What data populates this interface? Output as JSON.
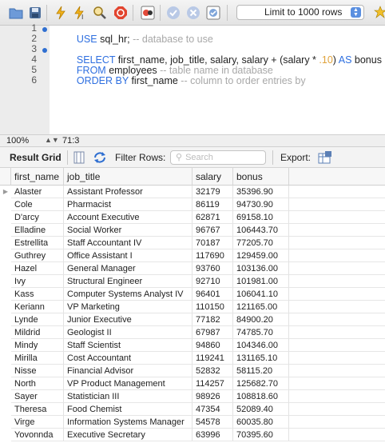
{
  "toolbar": {
    "limit_label": "Limit to 1000 rows",
    "icons": [
      "folder-icon",
      "save-icon",
      "execute-icon",
      "execute-current-icon",
      "explain-icon",
      "stop-icon",
      "toggle-error-icon",
      "commit-icon",
      "rollback-icon",
      "autocommit-icon",
      "beautify-icon"
    ]
  },
  "editor": {
    "line_numbers": [
      "1",
      "2",
      "3",
      "4",
      "5",
      "6"
    ],
    "lines": [
      {
        "kw1": "USE",
        "text1": " sql_hr; ",
        "comment": "-- database to use"
      },
      {
        "kw1": "",
        "text1": "",
        "comment": ""
      },
      {
        "kw1": "SELECT",
        "text1": " first_name, job_title, salary, salary + (salary * ",
        "num": ".10",
        "text2": ") ",
        "kw2": "AS",
        "text3": " bonus"
      },
      {
        "kw1": "FROM",
        "text1": " employees ",
        "comment": "-- table name in database"
      },
      {
        "kw1": "ORDER BY",
        "text1": " first_name ",
        "comment": "-- column to order entries by"
      },
      {
        "kw1": "",
        "text1": "",
        "comment": ""
      }
    ]
  },
  "status": {
    "zoom": "100%",
    "cursor": "71:3"
  },
  "result_bar": {
    "title": "Result Grid",
    "filter_label": "Filter Rows:",
    "search_placeholder": "Search",
    "export_label": "Export:"
  },
  "grid": {
    "columns": [
      "first_name",
      "job_title",
      "salary",
      "bonus"
    ],
    "rows": [
      [
        "Alaster",
        "Assistant Professor",
        "32179",
        "35396.90"
      ],
      [
        "Cole",
        "Pharmacist",
        "86119",
        "94730.90"
      ],
      [
        "D'arcy",
        "Account Executive",
        "62871",
        "69158.10"
      ],
      [
        "Elladine",
        "Social Worker",
        "96767",
        "106443.70"
      ],
      [
        "Estrellita",
        "Staff Accountant IV",
        "70187",
        "77205.70"
      ],
      [
        "Guthrey",
        "Office Assistant I",
        "117690",
        "129459.00"
      ],
      [
        "Hazel",
        "General Manager",
        "93760",
        "103136.00"
      ],
      [
        "Ivy",
        "Structural Engineer",
        "92710",
        "101981.00"
      ],
      [
        "Kass",
        "Computer Systems Analyst IV",
        "96401",
        "106041.10"
      ],
      [
        "Keriann",
        "VP Marketing",
        "110150",
        "121165.00"
      ],
      [
        "Lynde",
        "Junior Executive",
        "77182",
        "84900.20"
      ],
      [
        "Mildrid",
        "Geologist II",
        "67987",
        "74785.70"
      ],
      [
        "Mindy",
        "Staff Scientist",
        "94860",
        "104346.00"
      ],
      [
        "Mirilla",
        "Cost Accountant",
        "119241",
        "131165.10"
      ],
      [
        "Nisse",
        "Financial Advisor",
        "52832",
        "58115.20"
      ],
      [
        "North",
        "VP Product Management",
        "114257",
        "125682.70"
      ],
      [
        "Sayer",
        "Statistician III",
        "98926",
        "108818.60"
      ],
      [
        "Theresa",
        "Food Chemist",
        "47354",
        "52089.40"
      ],
      [
        "Virge",
        "Information Systems Manager",
        "54578",
        "60035.80"
      ],
      [
        "Yovonnda",
        "Executive Secretary",
        "63996",
        "70395.60"
      ]
    ]
  }
}
